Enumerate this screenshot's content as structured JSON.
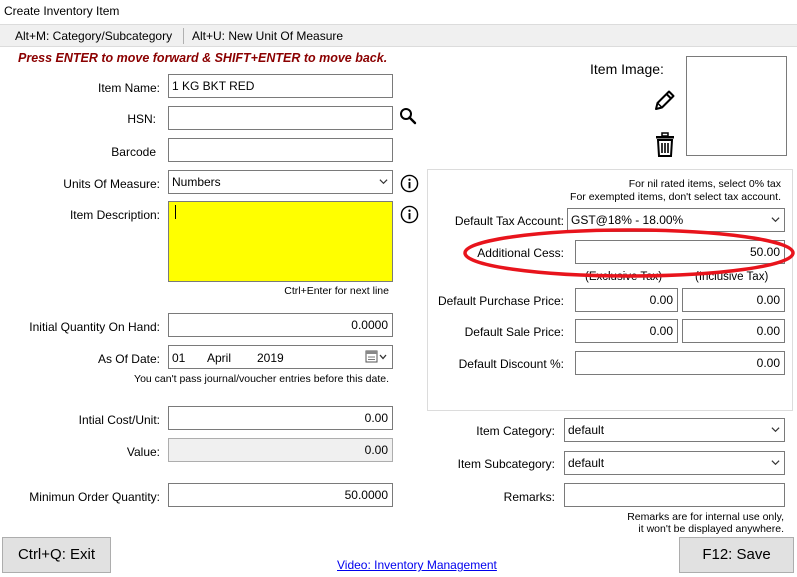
{
  "window": {
    "title": "Create Inventory Item"
  },
  "shortcuts": {
    "category": "Alt+M: Category/Subcategory",
    "unit": "Alt+U: New Unit Of Measure"
  },
  "hint": "Press ENTER to move forward & SHIFT+ENTER to move back.",
  "form": {
    "item_name": {
      "label": "Item Name:",
      "value": "1 KG BKT RED"
    },
    "hsn": {
      "label": "HSN:",
      "value": ""
    },
    "barcode": {
      "label": "Barcode",
      "value": ""
    },
    "units": {
      "label": "Units Of Measure:",
      "value": "Numbers"
    },
    "description": {
      "label": "Item Description:",
      "value": "",
      "note": "Ctrl+Enter for next line"
    },
    "initial_qty": {
      "label": "Initial Quantity On Hand:",
      "value": "0.0000"
    },
    "as_of_date": {
      "label": "As Of Date:",
      "day": "01",
      "month": "April",
      "year": "2019",
      "note": "You can't pass journal/voucher entries before this date."
    },
    "initial_cost": {
      "label": "Intial Cost/Unit:",
      "value": "0.00"
    },
    "value": {
      "label": "Value:",
      "value": "0.00"
    },
    "min_order": {
      "label": "Minimun Order Quantity:",
      "value": "50.0000"
    }
  },
  "tax": {
    "note1": "For nil rated items, select 0% tax",
    "note2": "For exempted items, don't select tax account.",
    "default_tax": {
      "label": "Default Tax Account:",
      "value": "GST@18% - 18.00%"
    },
    "cess": {
      "label": "Additional Cess:",
      "value": "50.00"
    },
    "exclusive_label": "(Exclusive Tax)",
    "inclusive_label": "(Inclusive Tax)",
    "purchase_price": {
      "label": "Default Purchase Price:",
      "exclusive": "0.00",
      "inclusive": "0.00"
    },
    "sale_price": {
      "label": "Default Sale Price:",
      "exclusive": "0.00",
      "inclusive": "0.00"
    },
    "discount": {
      "label": "Default Discount %:",
      "value": "0.00"
    }
  },
  "classification": {
    "category": {
      "label": "Item Category:",
      "value": "default"
    },
    "subcategory": {
      "label": "Item Subcategory:",
      "value": "default"
    },
    "remarks": {
      "label": "Remarks:",
      "value": "",
      "note1": "Remarks are for internal use only,",
      "note2": "it won't be displayed anywhere."
    }
  },
  "image": {
    "label": "Item Image:"
  },
  "footer": {
    "exit": "Ctrl+Q: Exit",
    "save": "F12: Save",
    "video_link": "Video: Inventory Management"
  },
  "colors": {
    "hint": "#8b0000",
    "description_bg": "#ffff00",
    "annotation": "#e8141c",
    "link": "#0000ee"
  },
  "icons": [
    "search-icon",
    "info-icon",
    "pencil-icon",
    "trash-icon",
    "calendar-icon",
    "chevron-down-icon"
  ]
}
